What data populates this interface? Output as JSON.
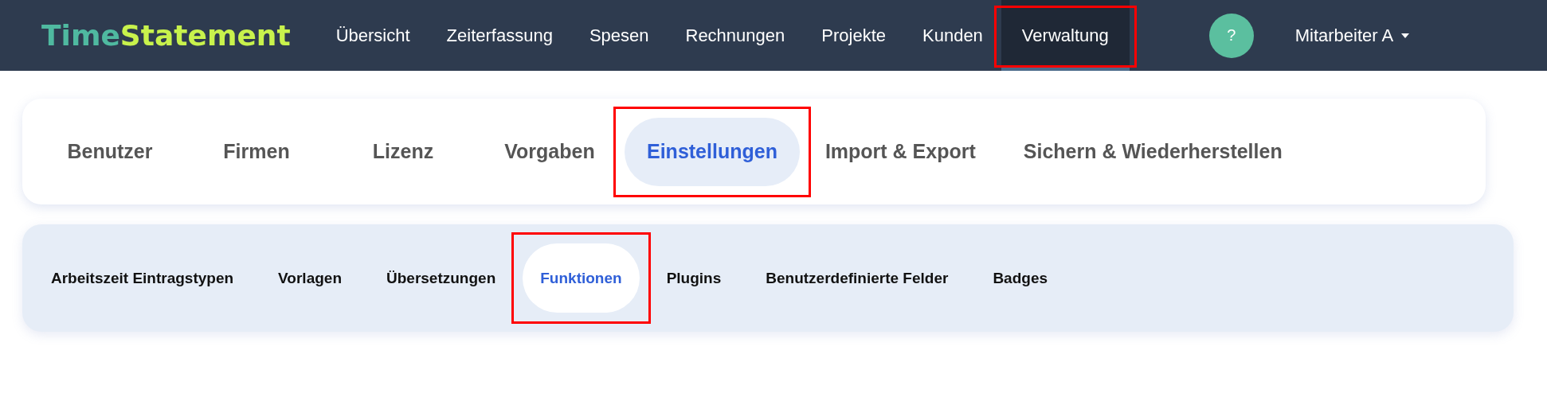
{
  "logo": {
    "part_1": "Time",
    "part_2": "Statement"
  },
  "nav": [
    {
      "label": "Übersicht",
      "selected": false,
      "highlighted": false
    },
    {
      "label": "Zeiterfassung",
      "selected": false,
      "highlighted": false
    },
    {
      "label": "Spesen",
      "selected": false,
      "highlighted": false
    },
    {
      "label": "Rechnungen",
      "selected": false,
      "highlighted": false
    },
    {
      "label": "Projekte",
      "selected": false,
      "highlighted": false
    },
    {
      "label": "Kunden",
      "selected": false,
      "highlighted": false
    },
    {
      "label": "Verwaltung",
      "selected": true,
      "highlighted": true
    }
  ],
  "help_button": "?",
  "user_menu": "Mitarbeiter A",
  "tabs": [
    {
      "label": "Benutzer",
      "selected": false,
      "highlighted": false
    },
    {
      "label": "Firmen",
      "selected": false,
      "highlighted": false
    },
    {
      "label": "Lizenz",
      "selected": false,
      "highlighted": false
    },
    {
      "label": "Vorgaben",
      "selected": false,
      "highlighted": false
    },
    {
      "label": "Einstellungen",
      "selected": true,
      "highlighted": true
    },
    {
      "label": "Import & Export",
      "selected": false,
      "highlighted": false
    },
    {
      "label": "Sichern & Wiederherstellen",
      "selected": false,
      "highlighted": false
    }
  ],
  "subtabs": [
    {
      "label": "Arbeitszeit Eintragstypen",
      "selected": false,
      "highlighted": false
    },
    {
      "label": "Vorlagen",
      "selected": false,
      "highlighted": false
    },
    {
      "label": "Übersetzungen",
      "selected": false,
      "highlighted": false
    },
    {
      "label": "Funktionen",
      "selected": true,
      "highlighted": true
    },
    {
      "label": "Plugins",
      "selected": false,
      "highlighted": false
    },
    {
      "label": "Benutzerdefinierte Felder",
      "selected": false,
      "highlighted": false
    },
    {
      "label": "Badges",
      "selected": false,
      "highlighted": false
    }
  ]
}
